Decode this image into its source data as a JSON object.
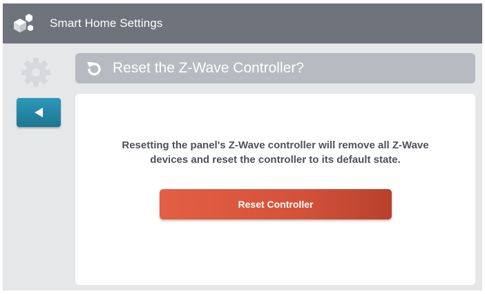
{
  "app": {
    "title": "Smart Home Settings",
    "logo_icon": "cubes-logo-icon"
  },
  "sidebar": {
    "settings_icon": "gear-icon",
    "back_icon": "back-arrow-icon"
  },
  "dialog": {
    "title": "Reset the Z-Wave Controller?",
    "title_icon": "reset-arrow-icon",
    "message_line1": "Resetting the panel's Z-Wave controller will remove all Z-Wave",
    "message_line2": "devices and reset the controller to its default state.",
    "action_label": "Reset Controller"
  },
  "colors": {
    "topbar": "#6f737b",
    "accent_blue": "#2d98b8",
    "danger": "#e35f44",
    "title_bar": "#b7bbc1",
    "background": "#e6e7e9"
  }
}
